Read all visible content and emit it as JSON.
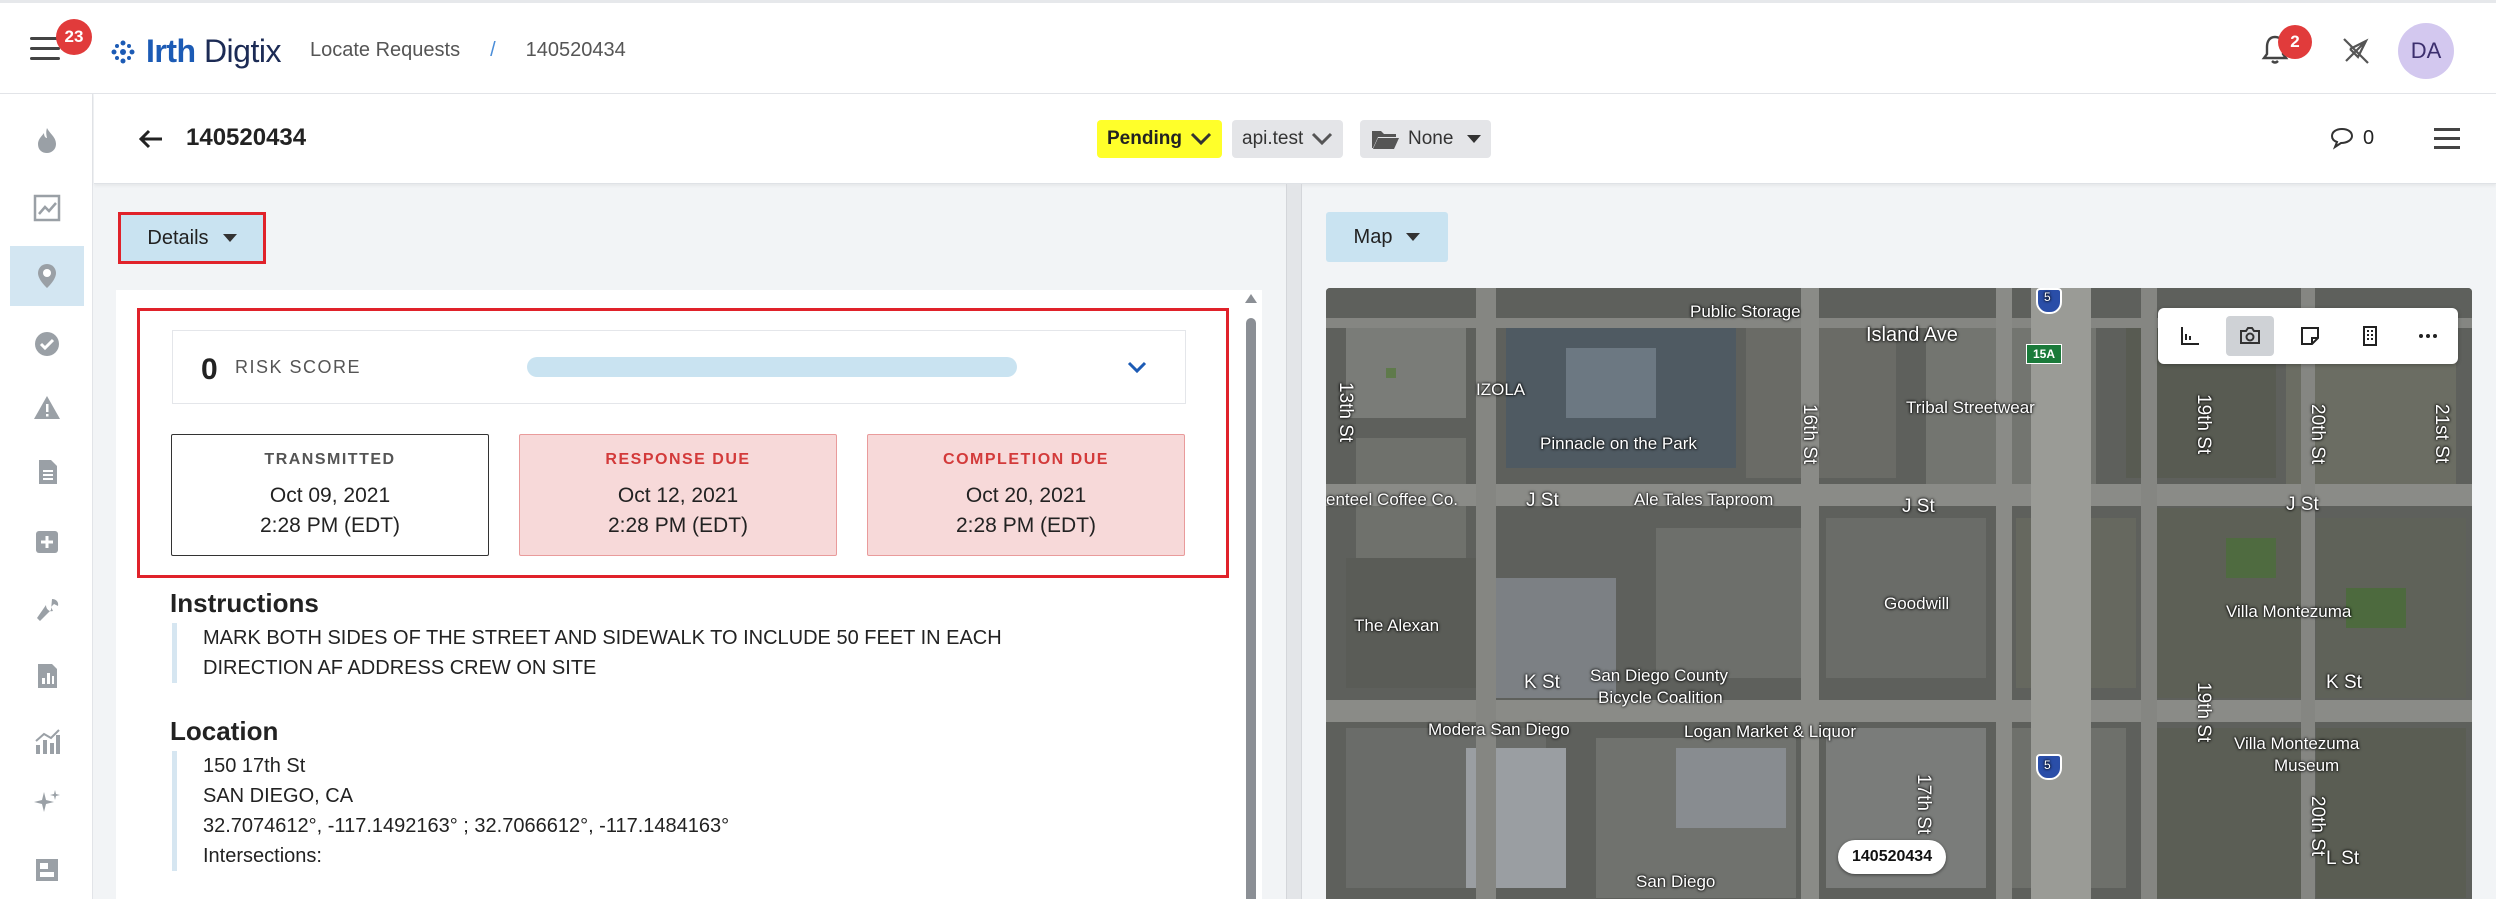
{
  "app": {
    "menu_badge": "23",
    "logo_bold": "Irth",
    "logo_rest": "Digtix",
    "breadcrumb": {
      "first": "Locate Requests",
      "separator": "/",
      "current": "140520434"
    },
    "notifications_badge": "2",
    "avatar_initials": "DA"
  },
  "header": {
    "title": "140520434",
    "status": "Pending",
    "assignee": "api.test",
    "folder": "None",
    "comment_count": "0"
  },
  "left_panel": {
    "view_selector": "Details",
    "risk": {
      "score": "0",
      "label": "RISK SCORE"
    },
    "dates": [
      {
        "label": "TRANSMITTED",
        "date": "Oct 09, 2021",
        "time": "2:28 PM (EDT)"
      },
      {
        "label": "RESPONSE DUE",
        "date": "Oct 12, 2021",
        "time": "2:28 PM (EDT)"
      },
      {
        "label": "COMPLETION DUE",
        "date": "Oct 20, 2021",
        "time": "2:28 PM (EDT)"
      }
    ],
    "instructions": {
      "title": "Instructions",
      "line1": "MARK BOTH SIDES OF THE STREET AND SIDEWALK TO INCLUDE 50 FEET IN EACH",
      "line2": "DIRECTION AF ADDRESS CREW ON SITE"
    },
    "location": {
      "title": "Location",
      "address": "150 17th St",
      "city": "SAN DIEGO, CA",
      "coords": "32.7074612°, -117.1492163° ; 32.7066612°, -117.1484163°",
      "intersections": "Intersections:"
    }
  },
  "right_panel": {
    "view_selector": "Map",
    "map": {
      "marker": "140520434",
      "labels": {
        "public_storage": "Public Storage",
        "island_ave": "Island Ave",
        "izola": "IZOLA",
        "tribal": "Tribal Streetwear",
        "pinnacle": "Pinnacle on the Park",
        "st16": "16th St",
        "st13": "13th St",
        "coffee": "enteel Coffee Co.",
        "j_st_1": "J St",
        "ale_tales": "Ale Tales Taproom",
        "j_st_2": "J St",
        "j_st_3": "J St",
        "st19": "19th St",
        "st20": "20th St",
        "st21": "21st St",
        "goodwill": "Goodwill",
        "villa1": "Villa Montezuma",
        "alexan": "The Alexan",
        "k_st_1": "K St",
        "sdcbc": "San Diego County",
        "sdcbc2": "Bicycle Coalition",
        "k_st_2": "K St",
        "modera": "Modera San Diego",
        "logan": "Logan Market & Liquor",
        "villa2": "Villa Montezuma",
        "museum": "Museum",
        "st17": "17th St",
        "st19b": "19th St",
        "st20b": "20th St",
        "l_st": "L St",
        "sandiego": "San Diego",
        "exit": "15A",
        "i5a": "5",
        "i5b": "5"
      }
    }
  }
}
